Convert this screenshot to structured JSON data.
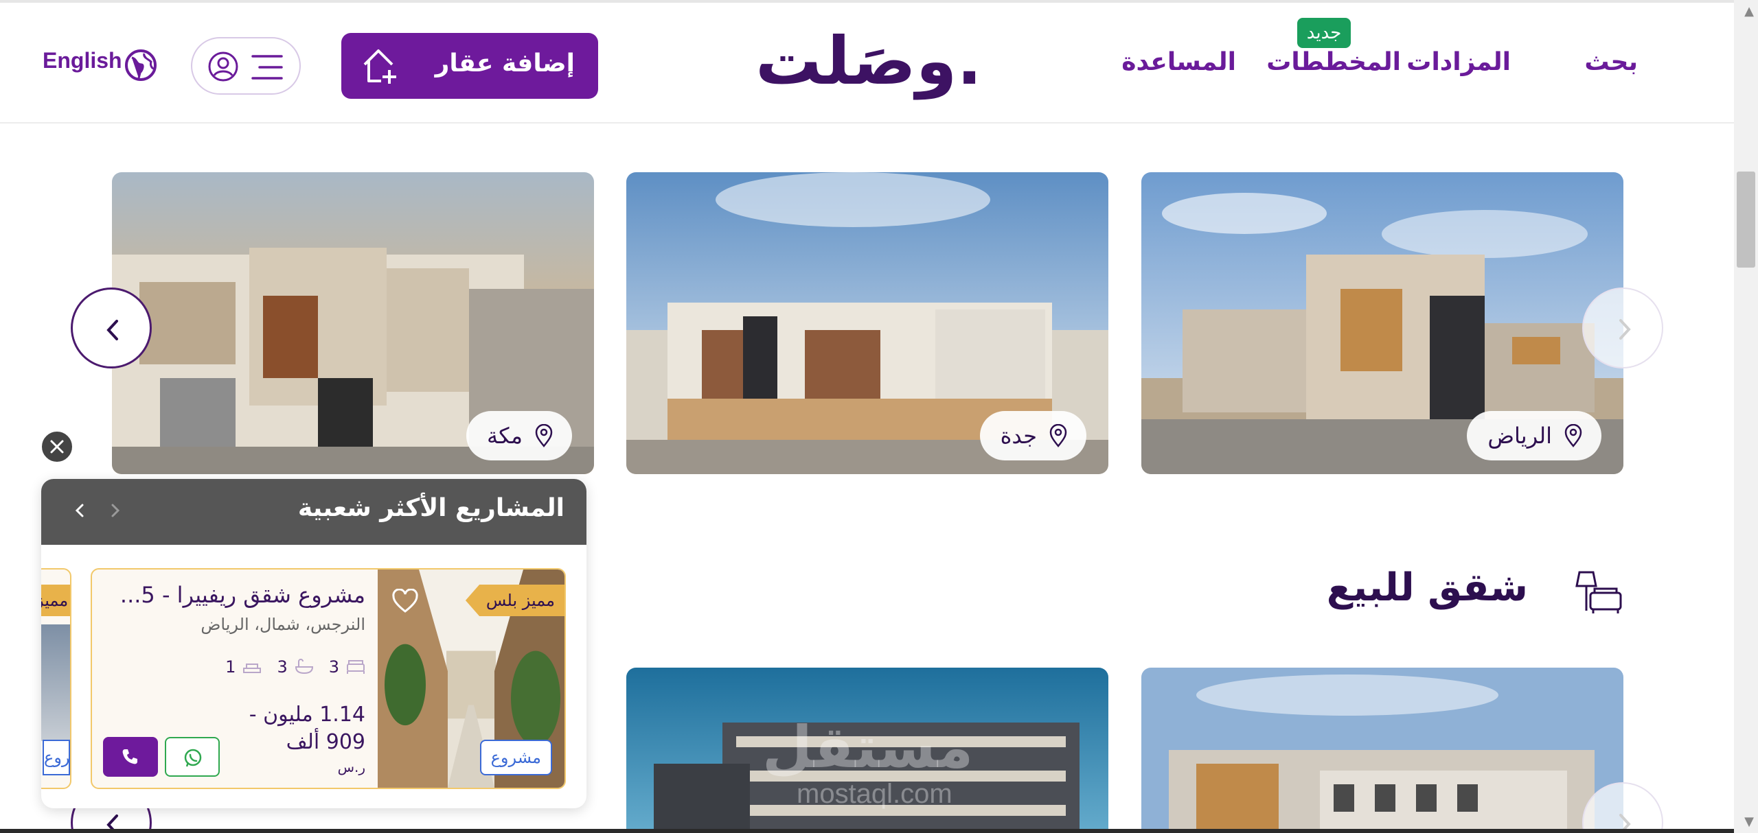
{
  "header": {
    "nav": {
      "search": "بحث",
      "auctions": "المزادات",
      "plans": "المخططات",
      "help": "المساعدة"
    },
    "new_badge": "جديد",
    "logo_text": "وصَلت.",
    "add_property": "إضافة عقار",
    "language": "English"
  },
  "cities": [
    {
      "name": "الرياض"
    },
    {
      "name": "جدة"
    },
    {
      "name": "مكة"
    }
  ],
  "apartments_section": {
    "title": "شقق للبيع"
  },
  "watermark": {
    "text": "مستقل",
    "sub": "mostaql.com"
  },
  "popup": {
    "title": "المشاريع الأكثر شعبية",
    "listing": {
      "badge": "مميز بلس",
      "title": "مشروع شقق ريفييرا - 5...",
      "location": "النرجس، شمال، الرياض",
      "beds": "3",
      "baths": "3",
      "living": "1",
      "price_line1": "1.14 مليون -",
      "price_line2": "909 ألف",
      "currency": "ر.س",
      "tag": "مشروع"
    },
    "peek": {
      "badge": "مميز",
      "tag": "مشروع"
    }
  },
  "colors": {
    "brand_purple": "#6e1a9c",
    "dark_purple": "#2d0f4f",
    "new_green": "#1a9e5c",
    "gold": "#e8b24a",
    "project_blue": "#3b6ad6"
  },
  "icons": [
    "home-plus-icon",
    "user-icon",
    "menu-icon",
    "globe-icon",
    "pin-icon",
    "chevron-left-icon",
    "chevron-right-icon",
    "sofa-icon",
    "heart-icon",
    "bed-icon",
    "bath-icon",
    "sofa-small-icon",
    "phone-icon",
    "whatsapp-icon",
    "close-icon"
  ]
}
